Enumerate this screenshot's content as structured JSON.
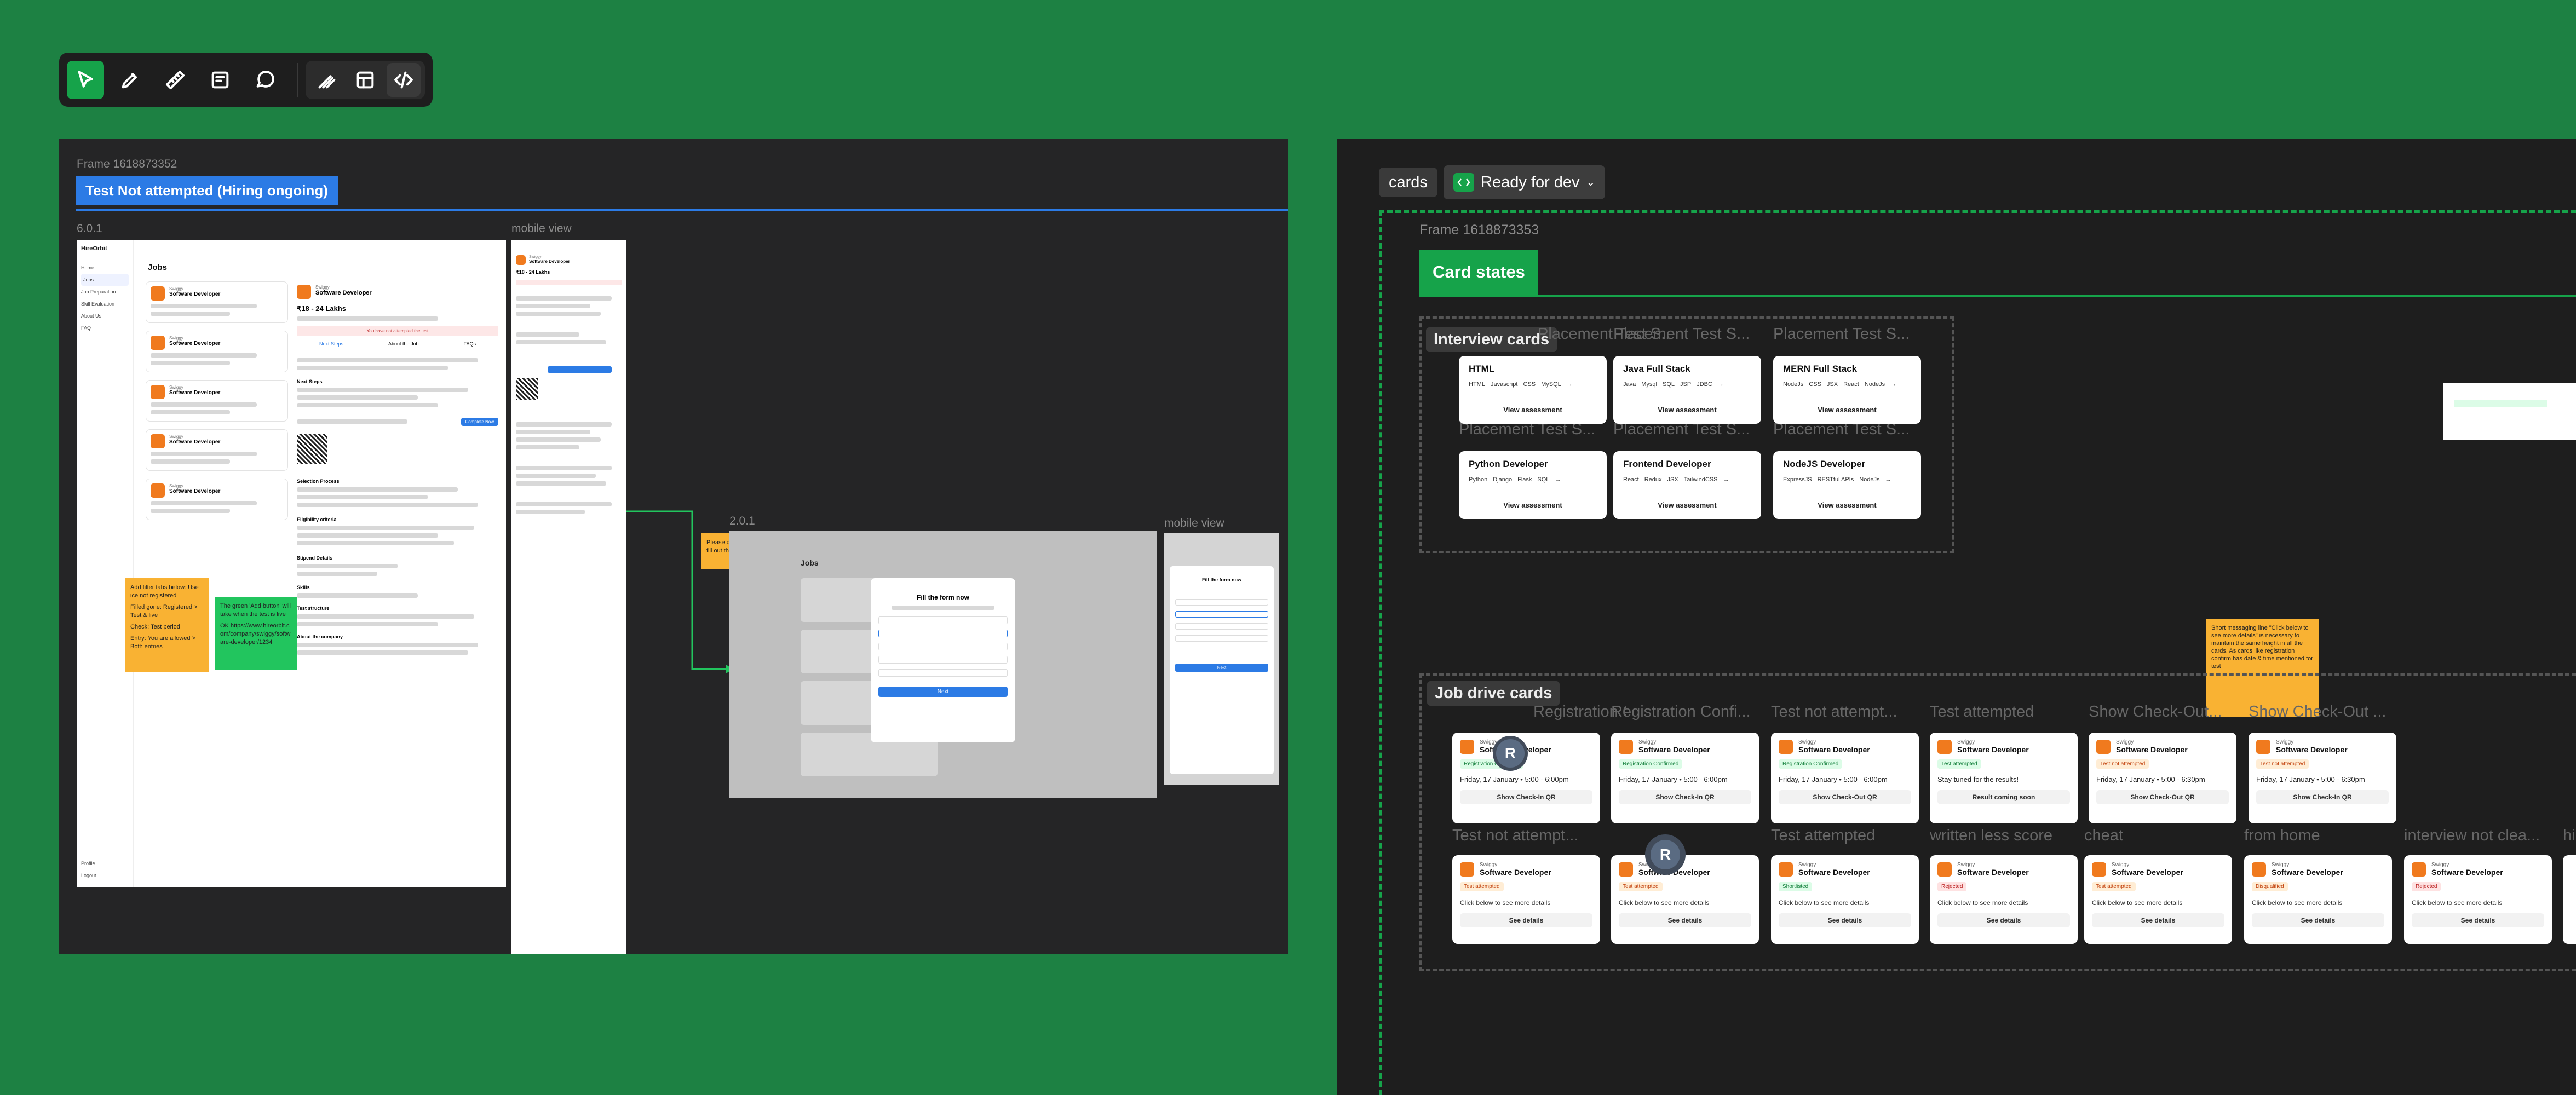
{
  "toolbar": {
    "tools": [
      "move-tool",
      "pen-tool",
      "ruler-tool",
      "text-tool",
      "comment-tool"
    ],
    "mode_tools": [
      "annotate",
      "inspect",
      "dev-mode"
    ]
  },
  "left_frame": {
    "frame_label": "Frame 1618873352",
    "section_tag": "Test Not attempted (Hiring ongoing)",
    "version_label": "6.0.1",
    "mobile_label": "mobile view",
    "version2_label": "2.0.1",
    "mobile2_label": "mobile view",
    "desktop": {
      "brand": "HireOrbit",
      "page_title": "Jobs",
      "nav": [
        "Home",
        "Jobs",
        "Job Preparation",
        "Skill Evaluation",
        "About Us",
        "FAQ"
      ],
      "footer_nav": [
        "Profile",
        "Logout"
      ],
      "list_company": "Swiggy",
      "list_role": "Software Developer",
      "detail_company": "Swiggy",
      "detail_role": "Software Developer",
      "salary": "₹18 - 24 Lakhs",
      "warning": "You have not attempted the test",
      "tabs": [
        "Next Steps",
        "About the Job",
        "FAQs"
      ],
      "sections": [
        "Next Steps",
        "Selection Process",
        "Eligibility criteria",
        "Stipend Details",
        "Skills",
        "Test structure",
        "About the company"
      ],
      "button": "Complete Now"
    },
    "modal": {
      "title": "Fill the form now",
      "cta": "Next"
    },
    "stickies": {
      "s1": [
        "Add filter tabs below: Use ice not registered",
        "Filled gone: Registered > Test & live",
        "Check: Test period",
        "Entry: You are allowed > Both entries"
      ],
      "s2": [
        "The green 'Add button' will take when the test is live",
        "OK https://www.hireorbit.com/company/swiggy/software-developer/1234"
      ],
      "s3": [
        "Please check if only can't fill out the form in time"
      ]
    }
  },
  "right_frame": {
    "cards_label": "cards",
    "status_label": "Ready for dev",
    "frame_label": "Frame 1618873353",
    "section_tag": "Card states",
    "interview_group": {
      "title": "Interview cards",
      "ghost_title": "Placement Test S...",
      "cards": [
        {
          "title": "HTML",
          "chips": [
            "HTML",
            "Javascript",
            "CSS",
            "MySQL"
          ],
          "action": "View assessment"
        },
        {
          "title": "Java Full Stack",
          "chips": [
            "Java",
            "Mysql",
            "SQL",
            "JSP",
            "JDBC"
          ],
          "action": "View assessment"
        },
        {
          "title": "MERN Full Stack",
          "chips": [
            "NodeJs",
            "CSS",
            "JSX",
            "React",
            "NodeJs"
          ],
          "action": "View assessment"
        },
        {
          "title": "Python Developer",
          "chips": [
            "Python",
            "Django",
            "Flask",
            "SQL"
          ],
          "action": "View assessment"
        },
        {
          "title": "Frontend Developer",
          "chips": [
            "React",
            "Redux",
            "JSX",
            "TailwindCSS"
          ],
          "action": "View assessment"
        },
        {
          "title": "NodeJS Developer",
          "chips": [
            "ExpressJS",
            "RESTful APIs",
            "NodeJs"
          ],
          "action": "View assessment"
        }
      ]
    },
    "job_group": {
      "title": "Job drive cards",
      "company": "Swiggy",
      "role": "Software Developer",
      "row1_titles": [
        "Registration Confi...",
        "Registration Confi...",
        "Test not attempt...",
        "Test attempted",
        "Show Check-Out...",
        "Show Check-Out ..."
      ],
      "row1": [
        {
          "badge": "Registration Confirmed",
          "type": "green",
          "date": "Friday, 17 January • 5:00 - 6:00pm",
          "action": "Show Check-In QR"
        },
        {
          "badge": "Registration Confirmed",
          "type": "green",
          "date": "Friday, 17 January • 5:00 - 6:00pm",
          "action": "Show Check-In QR"
        },
        {
          "badge": "Registration Confirmed",
          "type": "green",
          "date": "Friday, 17 January • 5:00 - 6:00pm",
          "action": "Show Check-Out QR"
        },
        {
          "badge": "Test attempted",
          "type": "green",
          "date": "Stay tuned for the results!",
          "action": "Result coming soon"
        },
        {
          "badge": "Test not attempted",
          "type": "orange",
          "date": "Friday, 17 January • 5:00 - 6:30pm",
          "action": "Show Check-Out QR"
        },
        {
          "badge": "Test not attempted",
          "type": "orange",
          "date": "Friday, 17 January • 5:00 - 6:30pm",
          "action": "Show Check-In QR"
        }
      ],
      "row2_titles": [
        "Test not attempt...",
        "",
        "Test attempted",
        "written less score",
        "cheat",
        "from home",
        "interview not clea...",
        "hi"
      ],
      "row2": [
        {
          "badge": "Test attempted",
          "type": "orange",
          "msg": "Click below to see more details",
          "action": "See details"
        },
        {
          "badge": "Test attempted",
          "type": "orange",
          "msg": "Click below to see more details",
          "action": "See details"
        },
        {
          "badge": "Shortlisted",
          "type": "green",
          "msg": "Click below to see more details",
          "action": "See details"
        },
        {
          "badge": "Rejected",
          "type": "red",
          "msg": "Click below to see more details",
          "action": "See details"
        },
        {
          "badge": "Test attempted",
          "type": "orange",
          "msg": "Click below to see more details",
          "action": "See details"
        },
        {
          "badge": "Disqualified",
          "type": "orange",
          "msg": "Click below to see more details",
          "action": "See details"
        },
        {
          "badge": "Rejected",
          "type": "red",
          "msg": "Click below to see more details",
          "action": "See details"
        }
      ]
    },
    "sticky_note": "Short messaging line \"Click below to see more details\" is necessary to maintain the same height in all the cards. As cards like registration confirm has date & time mentioned for test",
    "avatar_initial": "R"
  }
}
